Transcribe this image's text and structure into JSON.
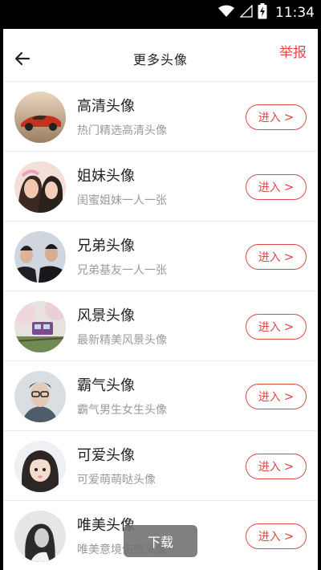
{
  "status_bar": {
    "time": "11:34",
    "icons": [
      "wifi-icon",
      "signal-icon",
      "battery-charging-icon"
    ]
  },
  "header": {
    "title": "更多头像",
    "report_label": "举报",
    "back_icon": "arrow-left-icon"
  },
  "categories": [
    {
      "title": "高清头像",
      "subtitle": "热门精选高清头像",
      "button_label": "进入",
      "button_icon": "chevron-right-icon",
      "avatar": "sports-car-photo"
    },
    {
      "title": "姐妹头像",
      "subtitle": "闺蜜姐妹一人一张",
      "button_label": "进入",
      "button_icon": "chevron-right-icon",
      "avatar": "two-girls-photo"
    },
    {
      "title": "兄弟头像",
      "subtitle": "兄弟基友一人一张",
      "button_label": "进入",
      "button_icon": "chevron-right-icon",
      "avatar": "two-men-photo"
    },
    {
      "title": "风景头像",
      "subtitle": "最新精美风景头像",
      "button_label": "进入",
      "button_icon": "chevron-right-icon",
      "avatar": "train-blossom-photo"
    },
    {
      "title": "霸气头像",
      "subtitle": "霸气男生女生头像",
      "button_label": "进入",
      "button_icon": "chevron-right-icon",
      "avatar": "man-glasses-photo"
    },
    {
      "title": "可爱头像",
      "subtitle": "可爱萌萌哒头像",
      "button_label": "进入",
      "button_icon": "chevron-right-icon",
      "avatar": "cute-girl-photo"
    },
    {
      "title": "唯美头像",
      "subtitle": "唯美意境伤感头像",
      "button_label": "进入",
      "button_icon": "chevron-right-icon",
      "avatar": "bw-girl-photo"
    }
  ],
  "download_toast": {
    "label": "下载"
  },
  "colors": {
    "accent": "#d84a4a",
    "report": "#e64848",
    "title_text": "#222222",
    "subtitle_text": "#9a9a9a",
    "divider": "#ececec"
  }
}
